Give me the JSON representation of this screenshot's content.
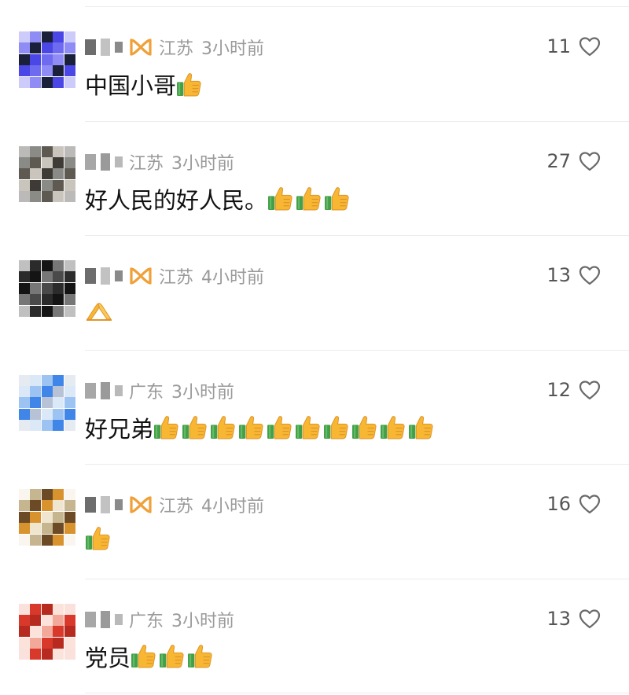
{
  "comments": [
    {
      "location": "江苏",
      "time": "3小时前",
      "text": "中国小哥",
      "emoji": [
        "thumbs-up"
      ],
      "likes": "11",
      "badge": true,
      "avatar_palette": [
        "#6e6bf0",
        "#4a47e6",
        "#1a1f3a",
        "#8f8cf5"
      ]
    },
    {
      "location": "江苏",
      "time": "3小时前",
      "text": "好人民的好人民。",
      "emoji": [
        "thumbs-up",
        "thumbs-up",
        "thumbs-up"
      ],
      "likes": "27",
      "badge": false,
      "avatar_palette": [
        "#8a8a86",
        "#3e3a35",
        "#c9c5bd",
        "#5e5a52"
      ]
    },
    {
      "location": "江苏",
      "time": "4小时前",
      "text": "",
      "emoji": [
        "folded-hands"
      ],
      "likes": "13",
      "badge": true,
      "avatar_palette": [
        "#141414",
        "#2b2b2b",
        "#4a4a4a",
        "#777777"
      ]
    },
    {
      "location": "广东",
      "time": "3小时前",
      "text": "好兄弟",
      "emoji": [
        "thumbs-up",
        "thumbs-up",
        "thumbs-up",
        "thumbs-up",
        "thumbs-up",
        "thumbs-up",
        "thumbs-up",
        "thumbs-up",
        "thumbs-up",
        "thumbs-up"
      ],
      "likes": "12",
      "badge": false,
      "avatar_palette": [
        "#3f86e8",
        "#9cc3f2",
        "#dbe8f8",
        "#b8c2d6"
      ]
    },
    {
      "location": "江苏",
      "time": "4小时前",
      "text": "",
      "emoji": [
        "thumbs-up"
      ],
      "likes": "16",
      "badge": true,
      "avatar_palette": [
        "#f0e6d0",
        "#d9932e",
        "#6b4a25",
        "#c6b68f"
      ]
    },
    {
      "location": "广东",
      "time": "3小时前",
      "text": "党员",
      "emoji": [
        "thumbs-up",
        "thumbs-up",
        "thumbs-up"
      ],
      "likes": "13",
      "badge": false,
      "avatar_palette": [
        "#d8392a",
        "#f3a99a",
        "#fbe3dc",
        "#b72a20"
      ]
    }
  ],
  "colors": {
    "meta_gray": "#9a9a9a",
    "badge_orange": "#f0a038",
    "thumb_yellow": "#f7b733",
    "thumb_green": "#43a047"
  }
}
